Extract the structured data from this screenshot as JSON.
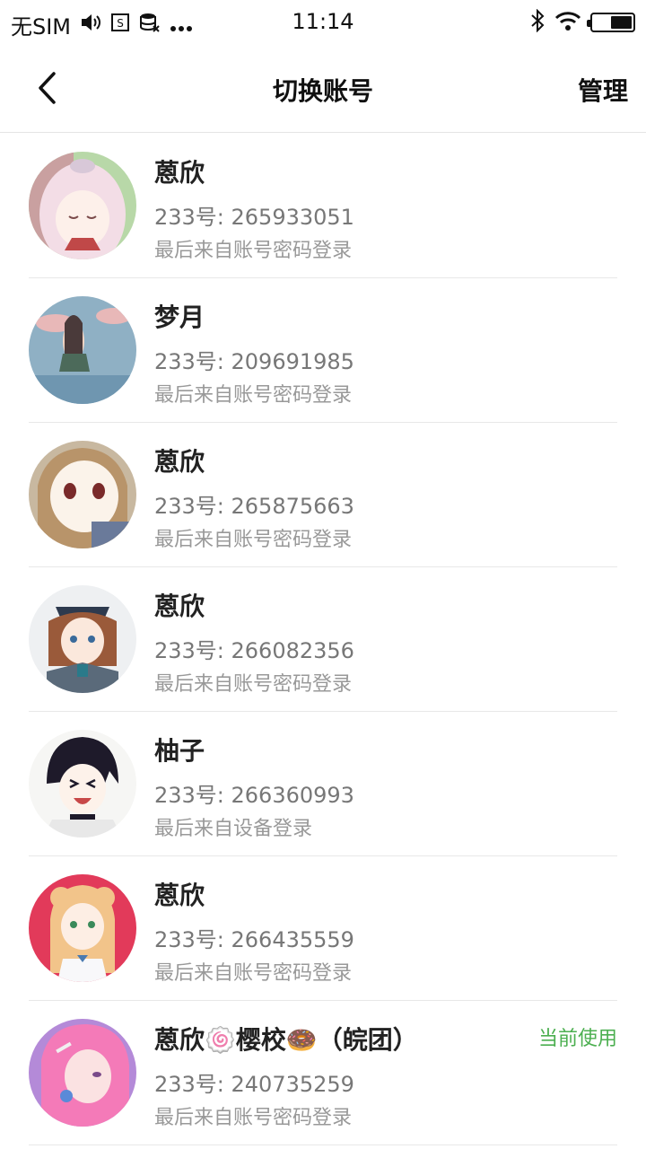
{
  "status_bar": {
    "carrier": "无SIM",
    "time": "11:14",
    "icons": [
      "volume-icon",
      "sim-icon",
      "data-icon",
      "more-dots-icon",
      "bluetooth-icon",
      "wifi-icon",
      "battery-icon"
    ],
    "battery_level": 0.55
  },
  "nav": {
    "title": "切换账号",
    "manage_label": "管理",
    "back_icon": "chevron-left-icon"
  },
  "accounts": [
    {
      "name": "蒽欣",
      "uid": "233号: 265933051",
      "login": "最后来自账号密码登录",
      "current": ""
    },
    {
      "name": "梦月",
      "uid": "233号: 209691985",
      "login": "最后来自账号密码登录",
      "current": ""
    },
    {
      "name": "蒽欣",
      "uid": "233号: 265875663",
      "login": "最后来自账号密码登录",
      "current": ""
    },
    {
      "name": "蒽欣",
      "uid": "233号: 266082356",
      "login": "最后来自账号密码登录",
      "current": ""
    },
    {
      "name": "柚子",
      "uid": "233号: 266360993",
      "login": "最后来自设备登录",
      "current": ""
    },
    {
      "name": "蒽欣",
      "uid": "233号: 266435559",
      "login": "最后来自账号密码登录",
      "current": ""
    },
    {
      "name": "蒽欣🍥樱校🍩（皖团）",
      "uid": "233号: 240735259",
      "login": "最后来自账号密码登录",
      "current": "当前使用"
    }
  ],
  "colors": {
    "accent_current": "#4caf50",
    "divider": "#e8e8e8",
    "text_primary": "#222222",
    "text_secondary": "#777777",
    "text_tertiary": "#999999"
  }
}
